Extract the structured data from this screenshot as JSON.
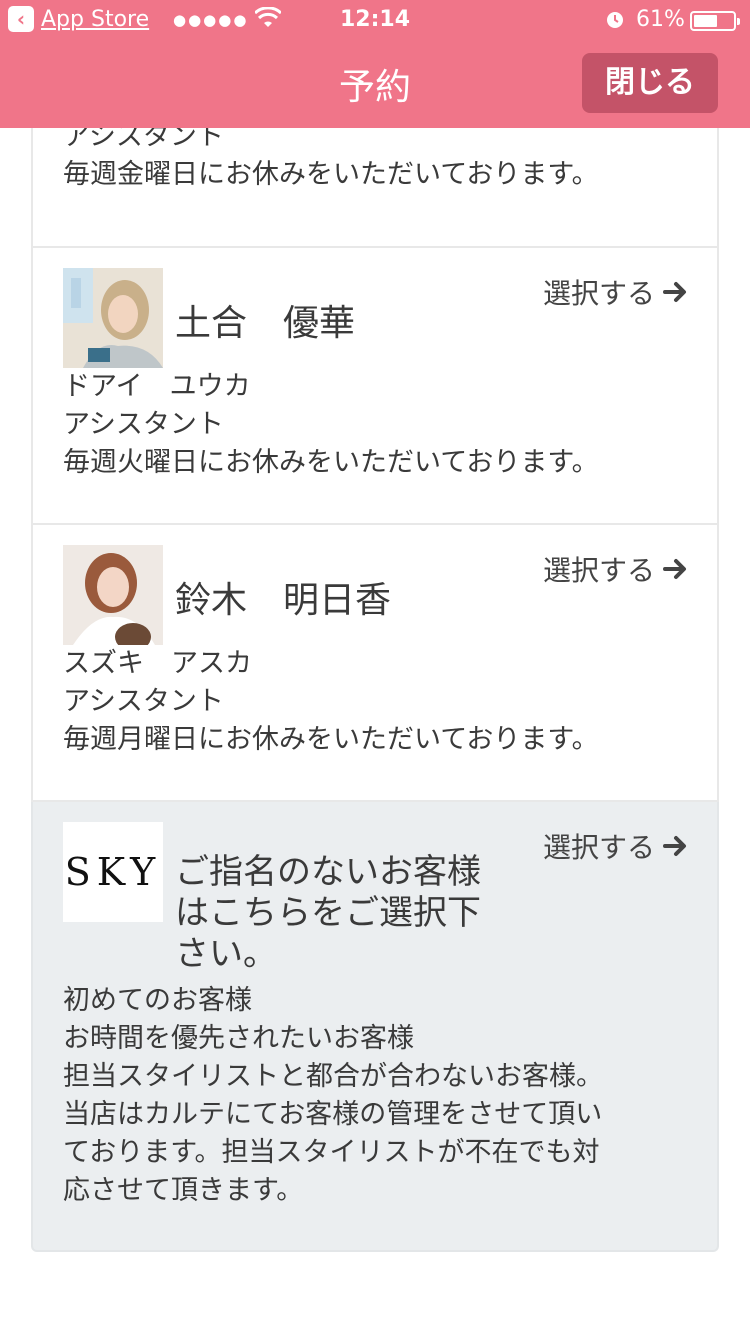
{
  "status_bar": {
    "back_app": "App Store",
    "signal": "●●●●●",
    "time": "12:14",
    "battery": "61%",
    "battery_level": 0.61
  },
  "nav": {
    "title": "予約",
    "close": "閉じる"
  },
  "select_label": "選択する",
  "stylists": [
    {
      "role": "アシスタント",
      "note": "毎週金曜日にお休みをいただいております。"
    },
    {
      "name": "土合　優華",
      "kana": "ドアイ　ユウカ",
      "role": "アシスタント",
      "note": "毎週火曜日にお休みをいただいております。"
    },
    {
      "name": "鈴木　明日香",
      "kana": "スズキ　アスカ",
      "role": "アシスタント",
      "note": "毎週月曜日にお休みをいただいております。"
    }
  ],
  "free_choice": {
    "logo": "·SKY·",
    "name_lines": [
      "ご指名のないお客様",
      "はこちらをご選択下",
      "さい。"
    ],
    "desc_lines": [
      "初めてのお客様",
      "お時間を優先されたいお客様",
      "担当スタイリストと都合が合わないお客様。",
      "当店はカルテにてお客様の管理をさせて頂い",
      "ております。担当スタイリストが不在でも対",
      "応させて頂きます。"
    ]
  },
  "colors": {
    "header": "#f07589",
    "close_button": "#c45368",
    "highlight_card": "#ebeef0"
  },
  "icons": [
    "back-icon",
    "wifi-icon",
    "alarm-icon",
    "battery-icon",
    "arrow-right-icon"
  ]
}
